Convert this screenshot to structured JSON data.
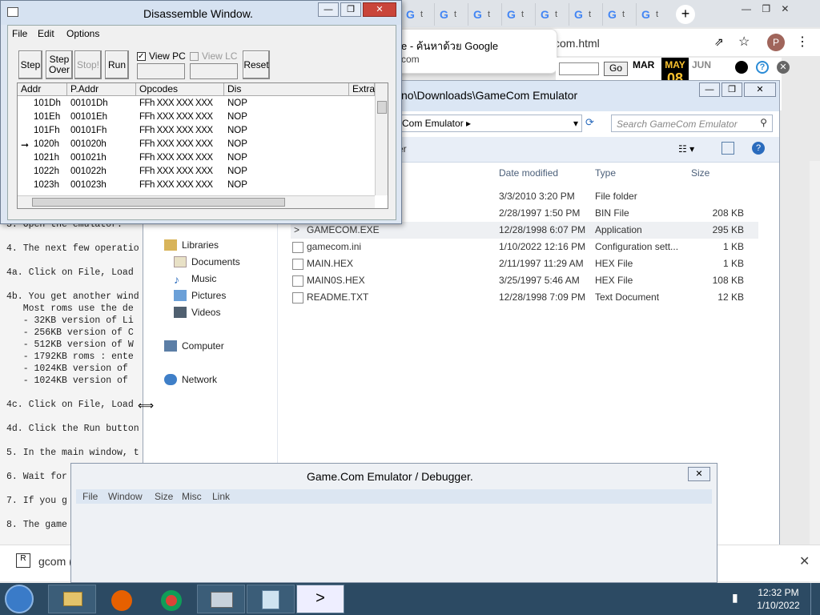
{
  "browser": {
    "tab_letters": [
      "G",
      "t"
    ],
    "new_tab": "+",
    "popup_title": "e - ค้นหาด้วย Google",
    "popup_sub": "com",
    "url_tail": "com.html",
    "go_label": "Go",
    "months": {
      "prev": "MAR",
      "current": "MAY",
      "next": "JUN",
      "day": "08"
    },
    "notification": {
      "text": "gcom (",
      "close": "✕"
    }
  },
  "doc_lines": [
    {
      "text": "3. Open the emulator."
    },
    {
      "text": "4. The next few operatio"
    },
    {
      "text": "4a. Click on File, Load"
    },
    {
      "text": "4b. You get another wind"
    },
    {
      "text": "   Most roms use the de"
    },
    {
      "text": "   - 32KB version of Li"
    },
    {
      "text": "   - 256KB version of C"
    },
    {
      "text": "   - 512KB version of W"
    },
    {
      "text": "   - 1792KB roms : ente"
    },
    {
      "text": "   - 1024KB version of"
    },
    {
      "text": "   - 1024KB version of"
    },
    {
      "text": "4c. Click on File, Load"
    },
    {
      "text": "4d. Click the Run button"
    },
    {
      "text": "5. In the main window, t"
    },
    {
      "text": "6. Wait for"
    },
    {
      "text": "7. If you g"
    },
    {
      "text": "8. The game"
    }
  ],
  "explorer": {
    "path": "no\\Downloads\\GameCom Emulator",
    "address": "Com Emulator ▸",
    "search_placeholder": "Search GameCom Emulator",
    "cmd_partial": "er",
    "columns": [
      "Date modified",
      "Type",
      "Size"
    ],
    "nav": [
      {
        "label": "Libraries",
        "icon": "libraries-icon"
      },
      {
        "label": "Documents",
        "icon": "documents-icon"
      },
      {
        "label": "Music",
        "icon": "music-icon"
      },
      {
        "label": "Pictures",
        "icon": "pictures-icon"
      },
      {
        "label": "Videos",
        "icon": "videos-icon"
      },
      {
        "label": "Computer",
        "icon": "computer-icon"
      },
      {
        "label": "Network",
        "icon": "network-icon"
      }
    ],
    "files": [
      {
        "name": "",
        "date": "3/3/2010 3:20 PM",
        "type": "File folder",
        "size": ""
      },
      {
        "name": "",
        "date": "2/28/1997 1:50 PM",
        "type": "BIN File",
        "size": "208 KB"
      },
      {
        "name": "GAMECOM.EXE",
        "date": "12/28/1998 6:07 PM",
        "type": "Application",
        "size": "295 KB"
      },
      {
        "name": "gamecom.ini",
        "date": "1/10/2022 12:16 PM",
        "type": "Configuration sett...",
        "size": "1 KB"
      },
      {
        "name": "MAIN.HEX",
        "date": "2/11/1997 11:29 AM",
        "type": "HEX File",
        "size": "1 KB"
      },
      {
        "name": "MAIN0S.HEX",
        "date": "3/25/1997 5:46 AM",
        "type": "HEX File",
        "size": "108 KB"
      },
      {
        "name": "README.TXT",
        "date": "12/28/1998 7:09 PM",
        "type": "Text Document",
        "size": "12 KB"
      }
    ]
  },
  "disasm": {
    "title": "Disassemble Window.",
    "menu": [
      "File",
      "Edit",
      "Options"
    ],
    "buttons": {
      "step": "Step",
      "step_over_1": "Step",
      "step_over_2": "Over",
      "stop": "Stop!",
      "run": "Run",
      "reset": "Reset"
    },
    "view_pc": "View PC",
    "view_lc": "View LC",
    "columns": [
      "Addr",
      "P.Addr",
      "Opcodes",
      "Dis",
      "Extra"
    ],
    "rows": [
      {
        "addr": "101Dh",
        "paddr": "00101Dh",
        "op": "FFh XXX XXX XXX",
        "dis": "NOP",
        "current": false
      },
      {
        "addr": "101Eh",
        "paddr": "00101Eh",
        "op": "FFh XXX XXX XXX",
        "dis": "NOP",
        "current": false
      },
      {
        "addr": "101Fh",
        "paddr": "00101Fh",
        "op": "FFh XXX XXX XXX",
        "dis": "NOP",
        "current": false
      },
      {
        "addr": "1020h",
        "paddr": "001020h",
        "op": "FFh XXX XXX XXX",
        "dis": "NOP",
        "current": true
      },
      {
        "addr": "1021h",
        "paddr": "001021h",
        "op": "FFh XXX XXX XXX",
        "dis": "NOP",
        "current": false
      },
      {
        "addr": "1022h",
        "paddr": "001022h",
        "op": "FFh XXX XXX XXX",
        "dis": "NOP",
        "current": false
      },
      {
        "addr": "1023h",
        "paddr": "001023h",
        "op": "FFh XXX XXX XXX",
        "dis": "NOP",
        "current": false
      }
    ]
  },
  "debugger": {
    "title": "Game.Com Emulator / Debugger.",
    "menu": [
      "File",
      "Window",
      "Size",
      "Misc",
      "Link"
    ],
    "close": "✕"
  },
  "taskbar": {
    "time": "12:32 PM",
    "date": "1/10/2022"
  }
}
